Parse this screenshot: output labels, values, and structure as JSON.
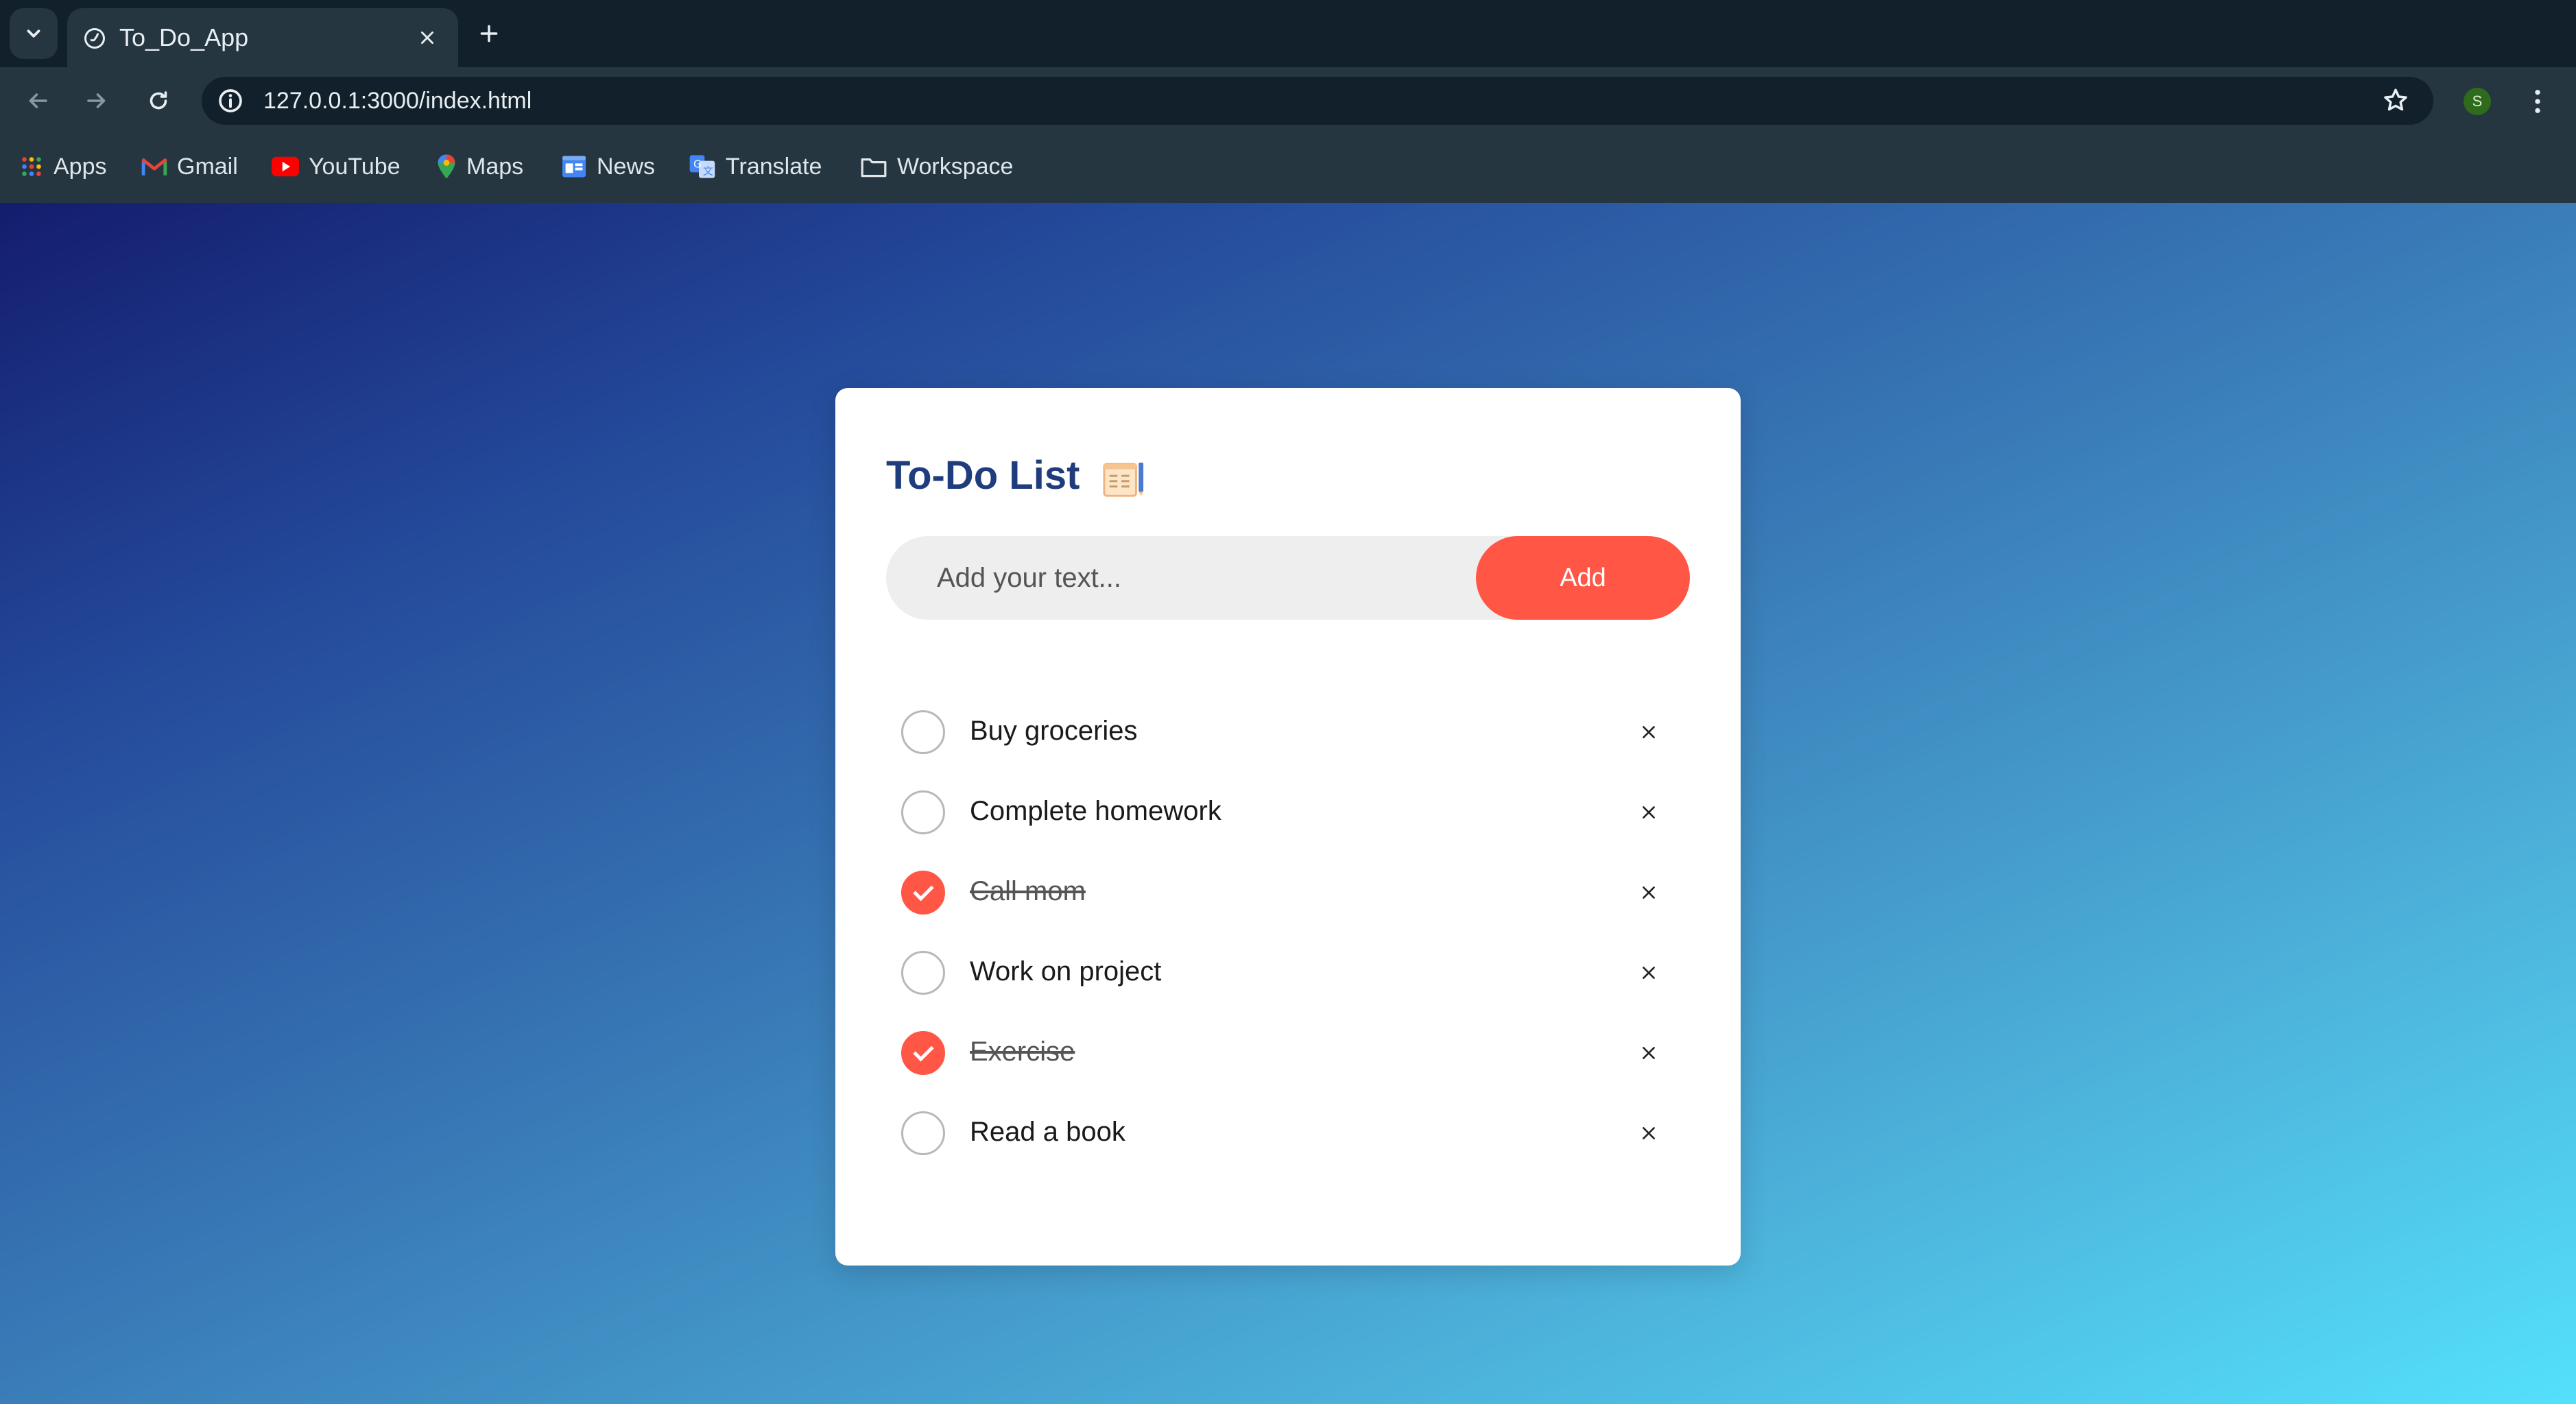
{
  "browser": {
    "tab_title": "To_Do_App",
    "url": "127.0.0.1:3000/index.html",
    "profile_initial": "S",
    "bookmarks": [
      {
        "label": "Apps",
        "icon": "apps-grid-icon"
      },
      {
        "label": "Gmail",
        "icon": "gmail-icon"
      },
      {
        "label": "YouTube",
        "icon": "youtube-icon"
      },
      {
        "label": "Maps",
        "icon": "maps-icon"
      },
      {
        "label": "News",
        "icon": "news-icon"
      },
      {
        "label": "Translate",
        "icon": "translate-icon"
      },
      {
        "label": "Workspace",
        "icon": "folder-icon"
      }
    ]
  },
  "app": {
    "title": "To-Do List",
    "title_icon": "notepad-icon",
    "input_placeholder": "Add your text...",
    "input_value": "",
    "add_label": "Add",
    "accent_color": "#ff5646",
    "tasks": [
      {
        "text": "Buy groceries",
        "done": false
      },
      {
        "text": "Complete homework",
        "done": false
      },
      {
        "text": "Call mom",
        "done": true
      },
      {
        "text": "Work on project",
        "done": false
      },
      {
        "text": "Exercise",
        "done": true
      },
      {
        "text": "Read a book",
        "done": false
      }
    ]
  }
}
